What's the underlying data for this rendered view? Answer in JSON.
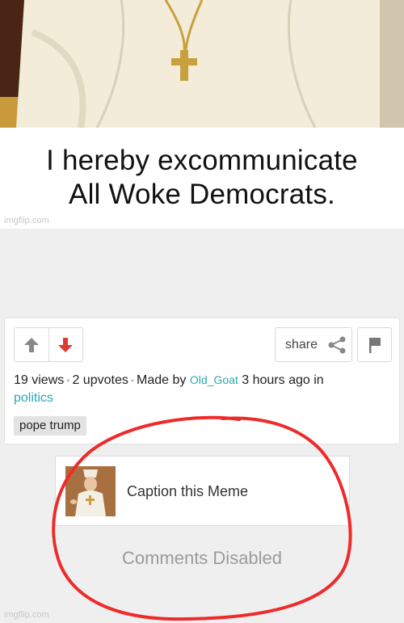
{
  "meme": {
    "caption_line1": "I hereby excommunicate",
    "caption_line2": "All Woke Democrats.",
    "watermark": "imgflip.com"
  },
  "post": {
    "upvote_icon": "arrow-up-icon",
    "downvote_icon": "arrow-down-icon",
    "share_label": "share",
    "views": "19 views",
    "upvotes": "2 upvotes",
    "made_by_prefix": "Made by",
    "author": "Old_Goat",
    "time_suffix": "3 hours ago in",
    "stream": "politics",
    "tag": "pope trump"
  },
  "caption_box": {
    "label": "Caption this Meme"
  },
  "comments": {
    "status": "Comments Disabled"
  },
  "footer": {
    "watermark": "imgflip.com"
  },
  "colors": {
    "link": "#2aa8b5",
    "downvote": "#e03a2f",
    "annotation_circle": "#ee2a2a"
  }
}
